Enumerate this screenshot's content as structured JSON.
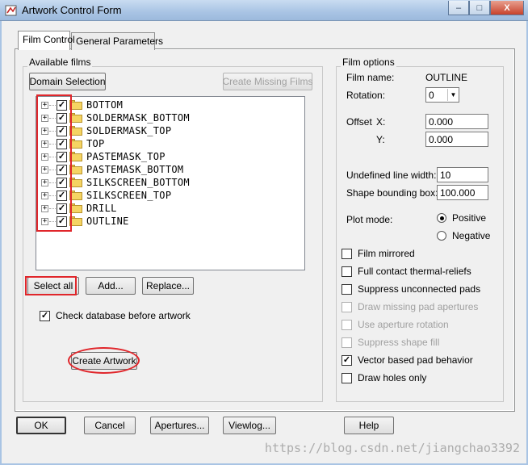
{
  "window": {
    "title": "Artwork Control Form",
    "minimize": "–",
    "maximize": "□",
    "close": "X"
  },
  "tabs": [
    {
      "label": "Film Control",
      "active": true
    },
    {
      "label": "General Parameters",
      "active": false
    }
  ],
  "available_films": {
    "group_title": "Available films",
    "domain_selection": "Domain Selection",
    "create_missing_films": "Create Missing Films",
    "films": [
      {
        "name": "BOTTOM",
        "checked": true
      },
      {
        "name": "SOLDERMASK_BOTTOM",
        "checked": true
      },
      {
        "name": "SOLDERMASK_TOP",
        "checked": true
      },
      {
        "name": "TOP",
        "checked": true
      },
      {
        "name": "PASTEMASK_TOP",
        "checked": true
      },
      {
        "name": "PASTEMASK_BOTTOM",
        "checked": true
      },
      {
        "name": "SILKSCREEN_BOTTOM",
        "checked": true
      },
      {
        "name": "SILKSCREEN_TOP",
        "checked": true
      },
      {
        "name": "DRILL",
        "checked": true
      },
      {
        "name": "OUTLINE",
        "checked": true
      }
    ],
    "select_all": "Select all",
    "add": "Add...",
    "replace": "Replace...",
    "check_database": {
      "label": "Check database before artwork",
      "checked": true
    },
    "create_artwork": "Create Artwork"
  },
  "film_options": {
    "group_title": "Film options",
    "film_name_label": "Film name:",
    "film_name_value": "OUTLINE",
    "rotation_label": "Rotation:",
    "rotation_value": "0",
    "offset_label": "Offset",
    "offset_x_label": "X:",
    "offset_x_value": "0.000",
    "offset_y_label": "Y:",
    "offset_y_value": "0.000",
    "undefined_line_width_label": "Undefined line width:",
    "undefined_line_width_value": "10",
    "shape_bounding_box_label": "Shape bounding box:",
    "shape_bounding_box_value": "100.000",
    "plot_mode_label": "Plot mode:",
    "plot_mode_options": [
      {
        "label": "Positive",
        "selected": true
      },
      {
        "label": "Negative",
        "selected": false
      }
    ],
    "checkboxes": [
      {
        "label": "Film mirrored",
        "checked": false,
        "enabled": true
      },
      {
        "label": "Full contact thermal-reliefs",
        "checked": false,
        "enabled": true
      },
      {
        "label": "Suppress unconnected pads",
        "checked": false,
        "enabled": true
      },
      {
        "label": "Draw missing pad apertures",
        "checked": false,
        "enabled": false
      },
      {
        "label": "Use aperture rotation",
        "checked": false,
        "enabled": false
      },
      {
        "label": "Suppress shape fill",
        "checked": false,
        "enabled": false
      },
      {
        "label": "Vector based pad behavior",
        "checked": true,
        "enabled": true
      },
      {
        "label": "Draw holes only",
        "checked": false,
        "enabled": true
      }
    ]
  },
  "bottom_buttons": {
    "ok": "OK",
    "cancel": "Cancel",
    "apertures": "Apertures...",
    "viewlog": "Viewlog...",
    "help": "Help"
  },
  "watermark": "https://blog.csdn.net/jiangchao3392",
  "colors": {
    "annotation": "#e0262b",
    "titlebar": "#a9c4e4",
    "folder": "#f5d463"
  }
}
